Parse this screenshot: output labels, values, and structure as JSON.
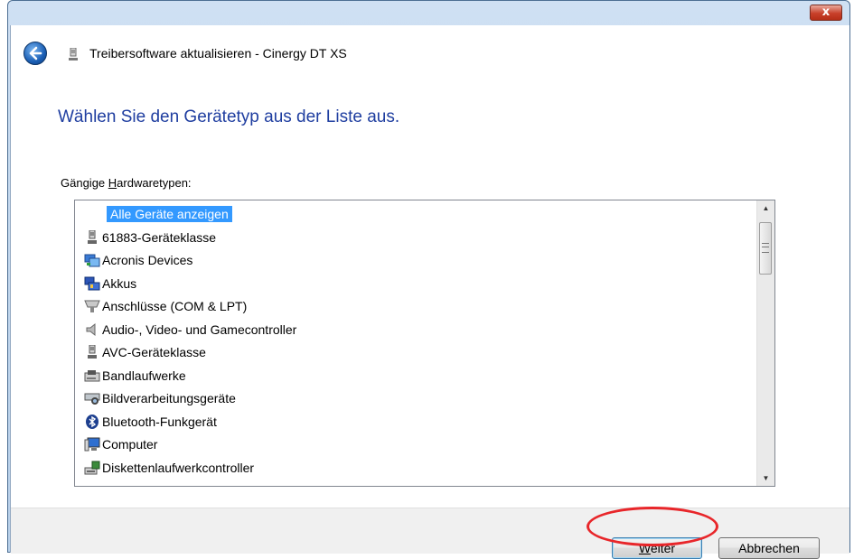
{
  "window": {
    "title": "Treibersoftware aktualisieren - Cinergy DT XS",
    "close_label": "x"
  },
  "page": {
    "heading": "Wählen Sie den Gerätetyp aus der Liste aus.",
    "list_label_prefix": "Gängige ",
    "list_label_accel": "H",
    "list_label_rest": "ardwaretypen:"
  },
  "device_list": {
    "selected": "Alle Geräte anzeigen",
    "items": [
      {
        "label": "Alle Geräte anzeigen",
        "icon": "none"
      },
      {
        "label": "61883-Geräteklasse",
        "icon": "connector-icon"
      },
      {
        "label": "Acronis Devices",
        "icon": "network-device-icon"
      },
      {
        "label": "Akkus",
        "icon": "battery-icon"
      },
      {
        "label": "Anschlüsse (COM & LPT)",
        "icon": "port-icon"
      },
      {
        "label": "Audio-, Video- und Gamecontroller",
        "icon": "speaker-icon"
      },
      {
        "label": "AVC-Geräteklasse",
        "icon": "connector-icon"
      },
      {
        "label": "Bandlaufwerke",
        "icon": "tape-drive-icon"
      },
      {
        "label": "Bildverarbeitungsgeräte",
        "icon": "scanner-icon"
      },
      {
        "label": "Bluetooth-Funkgerät",
        "icon": "bluetooth-icon"
      },
      {
        "label": "Computer",
        "icon": "computer-icon"
      },
      {
        "label": "Diskettenlaufwerkcontroller",
        "icon": "floppy-controller-icon"
      }
    ]
  },
  "buttons": {
    "next_accel": "W",
    "next_rest": "eiter",
    "cancel": "Abbrechen"
  },
  "colors": {
    "heading": "#1f3ea0",
    "selection": "#3399ff",
    "highlight_ring": "#e8262a"
  }
}
